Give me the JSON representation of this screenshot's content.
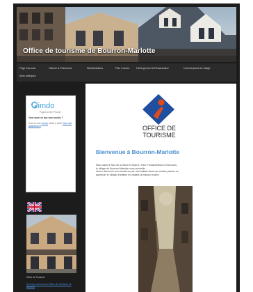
{
  "header": {
    "site_title": "Office de tourisme de Bourron-Marlotte"
  },
  "nav": {
    "items": [
      "Page d'accueil",
      "Histoire & Patrimoine",
      "Manifestations",
      "Plan d'accès",
      "Hébergement & Restauration",
      "Commerçants du village",
      "Infos pratiques"
    ]
  },
  "sidebar": {
    "jimdo": {
      "logo_word": "Jimdo",
      "tagline": "Pages to the People",
      "question": "Vous aussi ce que vous voulez ?",
      "text_before_link": "Créé en une",
      "link1": "minute",
      "text_middle": ", facile à créer",
      "link2": "Votre site gratuitement",
      "text_after": ""
    },
    "flag_icon": "uk-flag-icon",
    "photo_caption": "Office de Tourisme",
    "contact_link": "Devenez amis avec l'Office de Tourisme de Bourron"
  },
  "main": {
    "logo_line1": "OFFICE DE",
    "logo_line2": "TOURISME",
    "headline": "Bienvenue à Bourron-Marlotte",
    "intro": [
      "Situé dans le Sud de la Seine et Marne, entre Fontainebleau et Nemours,",
      "le village de Bourron-Marlotte vous accueille.",
      "Venez découvrir son nombreux par une balade dans ses ruelles pavées ou",
      "apprécier le village d'artistes en visitant la maison musée."
    ]
  },
  "colors": {
    "page_bg": "#1c1c1c",
    "nav_bg": "#2b2b2b",
    "headline": "#4a8fd0",
    "logo_blue": "#1f4f9e",
    "logo_orange": "#e24b1d"
  }
}
